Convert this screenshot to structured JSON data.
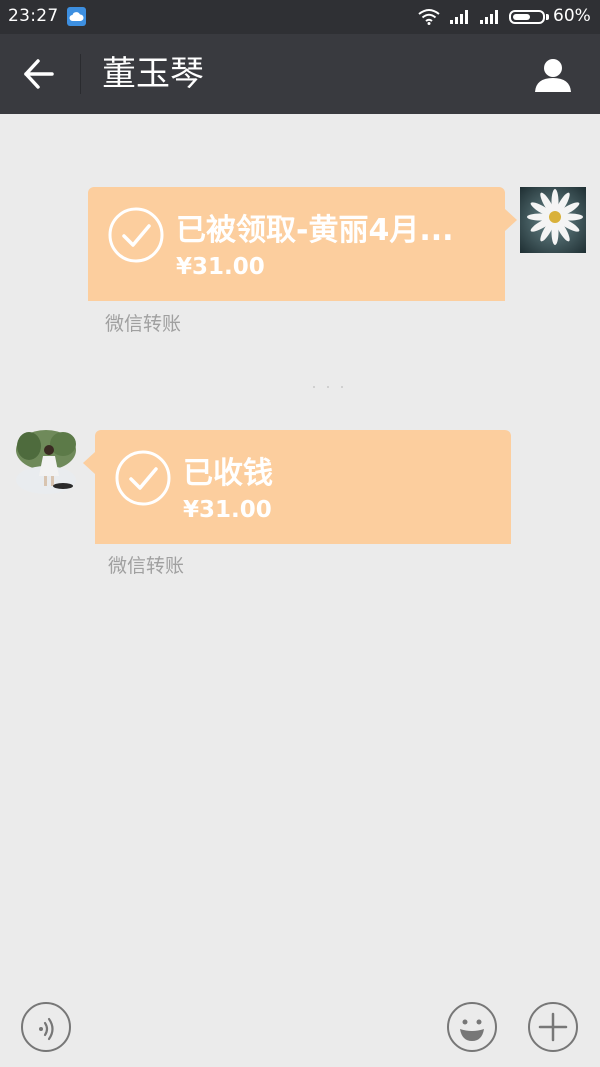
{
  "status_bar": {
    "time": "23:27",
    "battery_percent": "60%",
    "battery_level": 0.6,
    "icons": [
      "cloud-app-icon",
      "wifi-icon",
      "signal-icon",
      "signal-icon",
      "battery-icon"
    ]
  },
  "header": {
    "title": "董玉琴",
    "back_icon": "back-arrow-icon",
    "profile_icon": "person-icon"
  },
  "messages": [
    {
      "direction": "outgoing",
      "title": "已被领取-黄丽4月...",
      "amount": "¥31.00",
      "caption": "微信转账",
      "icon": "check-circle-icon"
    },
    {
      "direction": "incoming",
      "title": "已收钱",
      "amount": "¥31.00",
      "caption": "微信转账",
      "icon": "check-circle-icon"
    }
  ],
  "input_bar": {
    "icons": [
      "voice-icon",
      "emoji-icon",
      "plus-icon"
    ]
  },
  "colors": {
    "status_bar_bg": "#2f3034",
    "header_bg": "#393a3f",
    "chat_bg": "#ebebeb",
    "transfer_bubble": "#fcce9e",
    "caption_text": "#a0a0a0"
  }
}
